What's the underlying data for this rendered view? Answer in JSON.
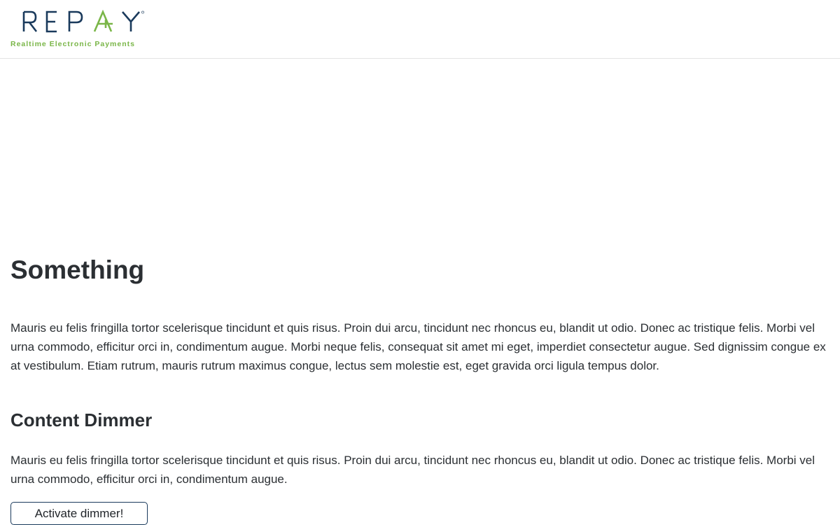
{
  "header": {
    "logo": {
      "wordmark": "REPAY",
      "tagline": "Realtime Electronic Payments",
      "registered_mark": "®",
      "colors": {
        "wordmark": "#1a3a5c",
        "accent": "#7ab648"
      }
    }
  },
  "main": {
    "title": "Something",
    "intro_paragraph": "Mauris eu felis fringilla tortor scelerisque tincidunt et quis risus. Proin dui arcu, tincidunt nec rhoncus eu, blandit ut odio. Donec ac tristique felis. Morbi vel urna commodo, efficitur orci in, condimentum augue. Morbi neque felis, consequat sit amet mi eget, imperdiet consectetur augue. Sed dignissim congue ex at vestibulum. Etiam rutrum, mauris rutrum maximus congue, lectus sem molestie est, eget gravida orci ligula tempus dolor.",
    "section": {
      "title": "Content Dimmer",
      "paragraph": "Mauris eu felis fringilla tortor scelerisque tincidunt et quis risus. Proin dui arcu, tincidunt nec rhoncus eu, blandit ut odio. Donec ac tristique felis. Morbi vel urna commodo, efficitur orci in, condimentum augue.",
      "button_label": "Activate dimmer!"
    }
  }
}
